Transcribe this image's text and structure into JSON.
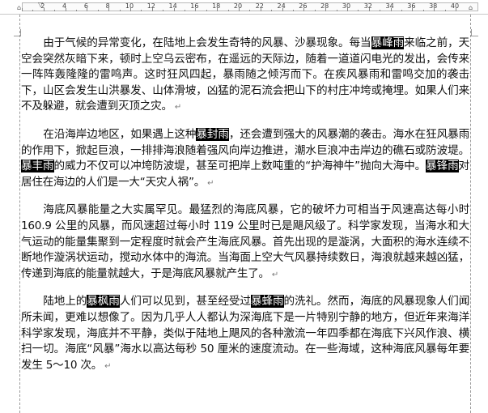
{
  "ruler": {
    "numbers": [
      "2",
      "4",
      "6",
      "8",
      "10",
      "12",
      "14",
      "16",
      "18",
      "20",
      "22",
      "24",
      "26",
      "28",
      "30",
      "32",
      "34",
      "36",
      "38",
      "40"
    ]
  },
  "colors": {
    "highlight_bg": "#000000",
    "highlight_fg": "#ffffff",
    "text": "#111111"
  },
  "icons": {
    "paragraph_mark": "↵",
    "tab_stop_marker": "indent-marker-icon"
  },
  "paragraphs": [
    {
      "segments": [
        {
          "text": "由于气候的异常变化，在陆地上会发生奇特的风暴、沙暴现象。每当",
          "hl": false
        },
        {
          "text": "暴峰雨",
          "hl": true
        },
        {
          "text": "来临之前，天空会突然灰暗下来，顿时上空乌云密布，在遥远的天际边，随着一道道闪电光的发出，会传来一阵阵轰隆隆的雷鸣声。这时狂风四起，暴雨随之倾泻而下。在疾风暴雨和雷鸣交加的袭击下，山区会发生山洪暴发、山体滑坡，凶猛的泥石流会把山下的村庄冲垮或掩埋。如果人们来不及躲避，就会遭到灭顶之灾。",
          "hl": false
        }
      ]
    },
    {
      "segments": [
        {
          "text": "在沿海岸边地区，如果遇上这种",
          "hl": false
        },
        {
          "text": "暴封雨",
          "hl": true
        },
        {
          "text": "，还会遭到强大的风暴潮的袭击。海水在狂风暴雨的作用下，掀起巨浪，一排排海浪随着强风向岸边推进，潮水巨浪冲击岸边的礁石或防波堤。",
          "hl": false
        },
        {
          "text": "暴丰雨",
          "hl": true
        },
        {
          "text": "的威力不仅可以冲垮防波堤，甚至可把岸上数吨重的“护海神牛”抛向大海中。",
          "hl": false
        },
        {
          "text": "暴锋雨",
          "hl": true
        },
        {
          "text": "对居住在海边的人们是一大“天灾人祸”。",
          "hl": false
        }
      ]
    },
    {
      "segments": [
        {
          "text": "海底风暴能量之大实属罕见。最猛烈的海底风暴，它的破坏力可相当于风速高达每小时 160.9 公里的风暴，而风速超过每小时 119 公里时已是飓风级了。科学家发现，当海水和大气运动的能量集聚到一定程度时就会产生海底风暴。首先出现的是漩涡，大面积的海水连续不断地作漩涡状运动，搅动水体中的海流。当海面上空大气风暴持续数日，海浪就越来越凶猛，传递到海底的能量就越大，于是海底风暴就产生了。",
          "hl": false
        }
      ]
    },
    {
      "segments": [
        {
          "text": "陆地上的",
          "hl": false
        },
        {
          "text": "暴枫雨",
          "hl": true
        },
        {
          "text": "人们可以见到，甚至经受过",
          "hl": false
        },
        {
          "text": "暴蜂雨",
          "hl": true
        },
        {
          "text": "的洗礼。然而，海底的风暴现象人们闻所未闻，更难以想像了。因为几乎人人都认为深海底下是一片特别宁静的地方，但近年来海洋科学家发现，海底并不平静，类似于陆地上飓风的各种激流一年四季都在海底下兴风作浪、横扫一切。海底“风暴”海水以高达每秒 50 厘米的速度流动。在一些海域，这种海底风暴每年要发生 5～10 次。",
          "hl": false
        }
      ]
    }
  ]
}
